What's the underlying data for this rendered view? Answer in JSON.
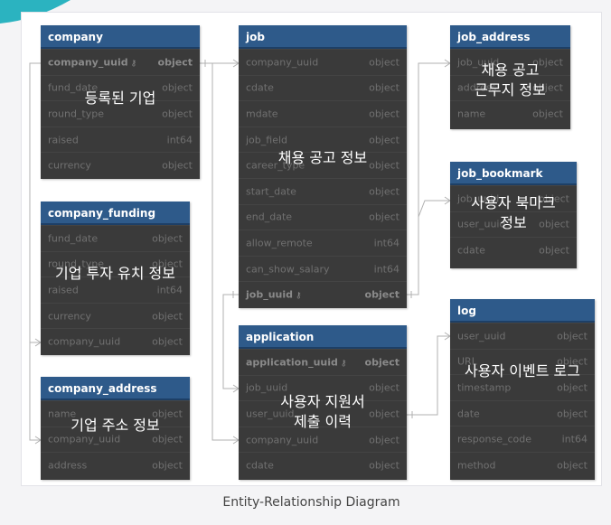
{
  "diagram": {
    "caption": "Entity-Relationship Diagram",
    "entities": {
      "company": {
        "title": "company",
        "overlay": "등록된 기업",
        "fields": [
          {
            "name": "company_uuid",
            "type": "object",
            "pk": true
          },
          {
            "name": "fund_date",
            "type": "object"
          },
          {
            "name": "round_type",
            "type": "object"
          },
          {
            "name": "raised",
            "type": "int64"
          },
          {
            "name": "currency",
            "type": "object"
          }
        ]
      },
      "company_funding": {
        "title": "company_funding",
        "overlay": "기업 투자 유치 정보",
        "fields": [
          {
            "name": "fund_date",
            "type": "object"
          },
          {
            "name": "round_type",
            "type": "object"
          },
          {
            "name": "raised",
            "type": "int64"
          },
          {
            "name": "currency",
            "type": "object"
          },
          {
            "name": "company_uuid",
            "type": "object"
          }
        ]
      },
      "company_address": {
        "title": "company_address",
        "overlay": "기업 주소 정보",
        "fields": [
          {
            "name": "name",
            "type": "object"
          },
          {
            "name": "company_uuid",
            "type": "object"
          },
          {
            "name": "address",
            "type": "object"
          }
        ]
      },
      "job": {
        "title": "job",
        "overlay": "채용 공고 정보",
        "fields": [
          {
            "name": "company_uuid",
            "type": "object"
          },
          {
            "name": "cdate",
            "type": "object"
          },
          {
            "name": "mdate",
            "type": "object"
          },
          {
            "name": "job_field",
            "type": "object"
          },
          {
            "name": "career_type",
            "type": "object"
          },
          {
            "name": "start_date",
            "type": "object"
          },
          {
            "name": "end_date",
            "type": "object"
          },
          {
            "name": "allow_remote",
            "type": "int64"
          },
          {
            "name": "can_show_salary",
            "type": "int64"
          },
          {
            "name": "job_uuid",
            "type": "object",
            "pk": true
          }
        ]
      },
      "application": {
        "title": "application",
        "overlay": "사용자 지원서\n제출 이력",
        "fields": [
          {
            "name": "application_uuid",
            "type": "object",
            "pk": true
          },
          {
            "name": "job_uuid",
            "type": "object"
          },
          {
            "name": "user_uuid",
            "type": "object"
          },
          {
            "name": "company_uuid",
            "type": "object"
          },
          {
            "name": "cdate",
            "type": "object"
          }
        ]
      },
      "job_address": {
        "title": "job_address",
        "overlay": "채용 공고\n근무지 정보",
        "fields": [
          {
            "name": "job_uuid",
            "type": "object"
          },
          {
            "name": "address",
            "type": "object"
          },
          {
            "name": "name",
            "type": "object"
          }
        ]
      },
      "job_bookmark": {
        "title": "job_bookmark",
        "overlay": "사용자 북마크\n정보",
        "fields": [
          {
            "name": "job_uuid",
            "type": "object"
          },
          {
            "name": "user_uuid",
            "type": "object"
          },
          {
            "name": "cdate",
            "type": "object"
          }
        ]
      },
      "log": {
        "title": "log",
        "overlay": "사용자 이벤트 로그",
        "fields": [
          {
            "name": "user_uuid",
            "type": "object"
          },
          {
            "name": "URL",
            "type": "object"
          },
          {
            "name": "timestamp",
            "type": "object"
          },
          {
            "name": "date",
            "type": "object"
          },
          {
            "name": "response_code",
            "type": "int64"
          },
          {
            "name": "method",
            "type": "object"
          }
        ]
      }
    }
  },
  "colors": {
    "header": "#2e5a8a",
    "body": "#3a3a3a",
    "connector": "#b0b0b0"
  }
}
